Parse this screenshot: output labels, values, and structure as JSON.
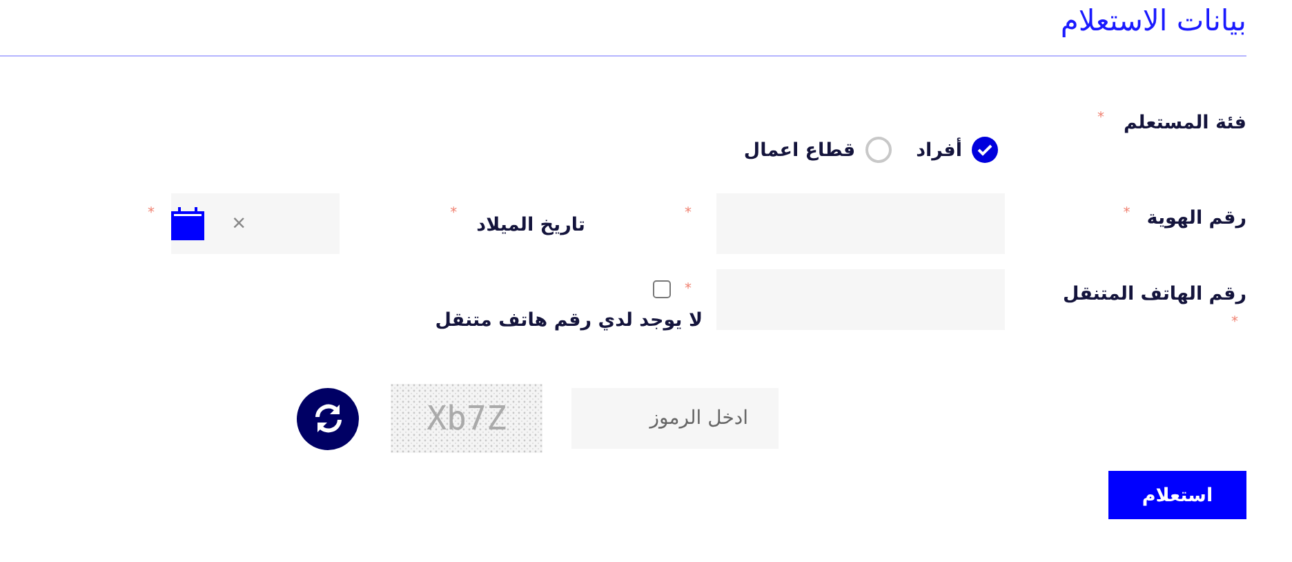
{
  "title": "بيانات الاستعلام",
  "requester_type": {
    "label": "فئة المستعلم",
    "mark": "*",
    "options": [
      {
        "label": "أفراد",
        "selected": true
      },
      {
        "label": "قطاع اعمال",
        "selected": false
      }
    ]
  },
  "id_number": {
    "label": "رقم الهوية",
    "label_mark": "*",
    "field_mark": "*"
  },
  "birth_date": {
    "label": "تاريخ الميلاد",
    "label_mark": "*",
    "clear": "×",
    "field_mark": "*"
  },
  "mobile": {
    "label": "رقم الهاتف المتنقل",
    "label_mark": "*",
    "field_mark": "*",
    "no_mobile": {
      "label": "لا يوجد لدي رقم هاتف متنقل",
      "checked": false
    }
  },
  "captcha": {
    "placeholder": "ادخل الرموز",
    "code": "Xb7Z"
  },
  "submit": "استعلام"
}
